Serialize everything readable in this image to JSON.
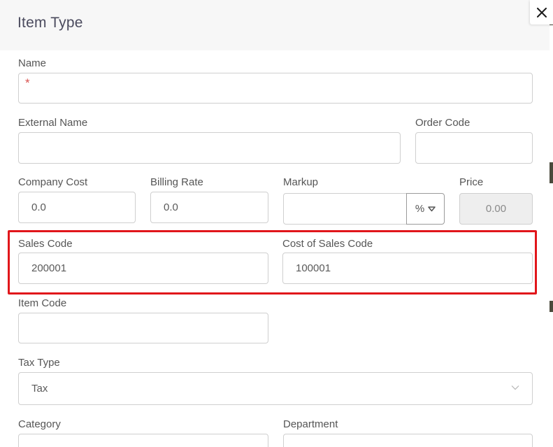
{
  "dialog": {
    "title": "Item Type",
    "close_label": "close"
  },
  "form": {
    "name": {
      "label": "Name",
      "value": "",
      "required_mark": "*"
    },
    "external_name": {
      "label": "External Name",
      "value": ""
    },
    "order_code": {
      "label": "Order Code",
      "value": ""
    },
    "company_cost": {
      "label": "Company Cost",
      "value": "0.0"
    },
    "billing_rate": {
      "label": "Billing Rate",
      "value": "0.0"
    },
    "markup": {
      "label": "Markup",
      "value": "",
      "unit": "%"
    },
    "price": {
      "label": "Price",
      "value": "0.00"
    },
    "sales_code": {
      "label": "Sales Code",
      "value": "200001"
    },
    "cost_of_sales_code": {
      "label": "Cost of Sales Code",
      "value": "100001"
    },
    "item_code": {
      "label": "Item Code",
      "value": ""
    },
    "tax_type": {
      "label": "Tax Type",
      "value": "Tax"
    },
    "category": {
      "label": "Category",
      "value": ""
    },
    "department": {
      "label": "Department",
      "value": ""
    }
  },
  "annotation": {
    "highlight_color": "#e1161b"
  },
  "icons": {
    "close": "close-icon",
    "unit_caret": "caret-down-icon",
    "select_chevron": "chevron-down-icon"
  }
}
